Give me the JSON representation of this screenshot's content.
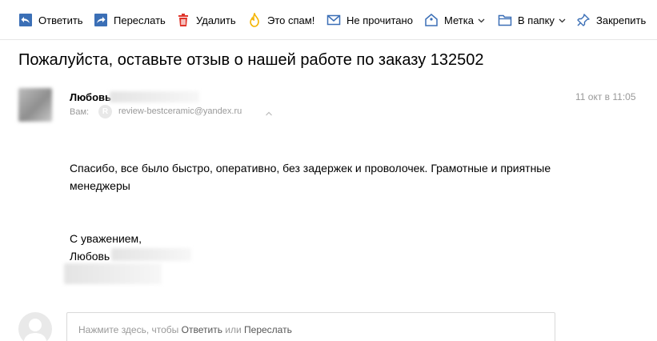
{
  "toolbar": {
    "reply": "Ответить",
    "forward": "Переслать",
    "delete": "Удалить",
    "spam": "Это спам!",
    "unread": "Не прочитано",
    "label": "Метка",
    "folder": "В папку",
    "pin": "Закрепить"
  },
  "message": {
    "subject": "Пожалуйста, оставьте отзыв о нашей работе по заказу 132502",
    "sender_name": "Любовь",
    "to_label": "Вам:",
    "to_avatar_letter": "R",
    "to_email": "review-bestceramic@yandex.ru",
    "date": "11 окт в 11:05",
    "body": "Спасибо, все было быстро, оперативно, без задержек и проволочек. Грамотные и приятные менеджеры",
    "signature_greeting": "С уважением,",
    "signature_name": "Любовь"
  },
  "reply": {
    "prefix": "Нажмите здесь, чтобы ",
    "reply_link": "Ответить",
    "or": " или ",
    "forward_link": "Переслать"
  },
  "colors": {
    "icon_blue": "#3b6fb6",
    "delete_red": "#e0352b",
    "spam_yellow": "#f4b400",
    "muted_text": "#999999"
  }
}
